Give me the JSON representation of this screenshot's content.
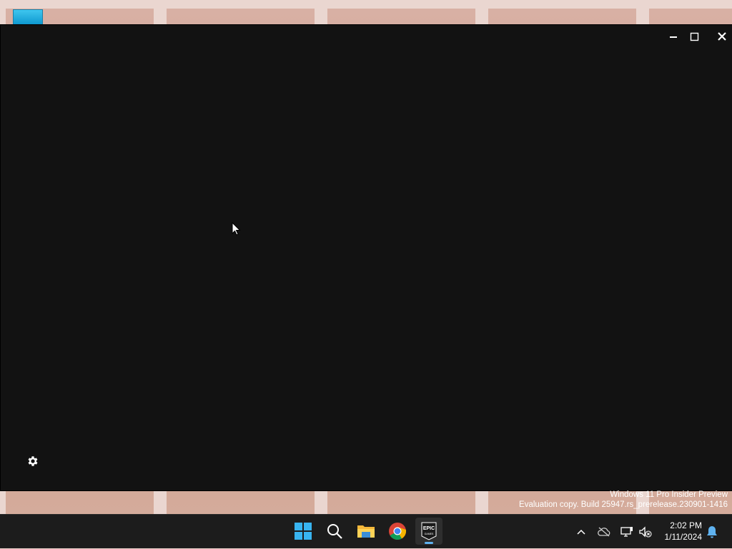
{
  "window": {
    "title": "",
    "controls": {
      "minimize": "minimize",
      "maximize": "maximize",
      "close": "close"
    }
  },
  "watermark": {
    "line1": "Windows 11 Pro Insider Preview",
    "line2": "Evaluation copy. Build 25947.rs_prerelease.230901-1416"
  },
  "taskbar": {
    "apps": [
      "start",
      "search",
      "file-explorer",
      "chrome",
      "epic-games-launcher"
    ],
    "epic_label_top": "EPIC",
    "epic_label_bottom": "GAMES",
    "active_app": "epic-games-launcher"
  },
  "tray": {
    "time": "2:02 PM",
    "date": "1/11/2024"
  },
  "colors": {
    "window_bg": "#121212",
    "taskbar_bg": "#1c1c1c",
    "accent": "#5fb2f0"
  }
}
